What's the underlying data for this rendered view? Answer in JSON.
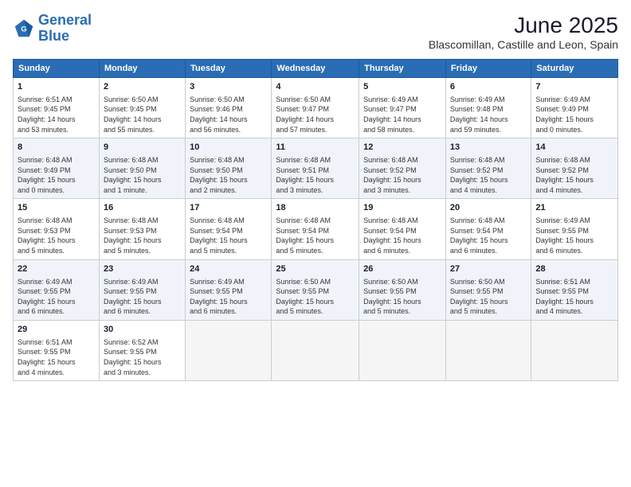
{
  "logo": {
    "line1": "General",
    "line2": "Blue"
  },
  "title": "June 2025",
  "subtitle": "Blascomillan, Castille and Leon, Spain",
  "headers": [
    "Sunday",
    "Monday",
    "Tuesday",
    "Wednesday",
    "Thursday",
    "Friday",
    "Saturday"
  ],
  "weeks": [
    [
      {
        "day": "1",
        "info": "Sunrise: 6:51 AM\nSunset: 9:45 PM\nDaylight: 14 hours\nand 53 minutes."
      },
      {
        "day": "2",
        "info": "Sunrise: 6:50 AM\nSunset: 9:45 PM\nDaylight: 14 hours\nand 55 minutes."
      },
      {
        "day": "3",
        "info": "Sunrise: 6:50 AM\nSunset: 9:46 PM\nDaylight: 14 hours\nand 56 minutes."
      },
      {
        "day": "4",
        "info": "Sunrise: 6:50 AM\nSunset: 9:47 PM\nDaylight: 14 hours\nand 57 minutes."
      },
      {
        "day": "5",
        "info": "Sunrise: 6:49 AM\nSunset: 9:47 PM\nDaylight: 14 hours\nand 58 minutes."
      },
      {
        "day": "6",
        "info": "Sunrise: 6:49 AM\nSunset: 9:48 PM\nDaylight: 14 hours\nand 59 minutes."
      },
      {
        "day": "7",
        "info": "Sunrise: 6:49 AM\nSunset: 9:49 PM\nDaylight: 15 hours\nand 0 minutes."
      }
    ],
    [
      {
        "day": "8",
        "info": "Sunrise: 6:48 AM\nSunset: 9:49 PM\nDaylight: 15 hours\nand 0 minutes."
      },
      {
        "day": "9",
        "info": "Sunrise: 6:48 AM\nSunset: 9:50 PM\nDaylight: 15 hours\nand 1 minute."
      },
      {
        "day": "10",
        "info": "Sunrise: 6:48 AM\nSunset: 9:50 PM\nDaylight: 15 hours\nand 2 minutes."
      },
      {
        "day": "11",
        "info": "Sunrise: 6:48 AM\nSunset: 9:51 PM\nDaylight: 15 hours\nand 3 minutes."
      },
      {
        "day": "12",
        "info": "Sunrise: 6:48 AM\nSunset: 9:52 PM\nDaylight: 15 hours\nand 3 minutes."
      },
      {
        "day": "13",
        "info": "Sunrise: 6:48 AM\nSunset: 9:52 PM\nDaylight: 15 hours\nand 4 minutes."
      },
      {
        "day": "14",
        "info": "Sunrise: 6:48 AM\nSunset: 9:52 PM\nDaylight: 15 hours\nand 4 minutes."
      }
    ],
    [
      {
        "day": "15",
        "info": "Sunrise: 6:48 AM\nSunset: 9:53 PM\nDaylight: 15 hours\nand 5 minutes."
      },
      {
        "day": "16",
        "info": "Sunrise: 6:48 AM\nSunset: 9:53 PM\nDaylight: 15 hours\nand 5 minutes."
      },
      {
        "day": "17",
        "info": "Sunrise: 6:48 AM\nSunset: 9:54 PM\nDaylight: 15 hours\nand 5 minutes."
      },
      {
        "day": "18",
        "info": "Sunrise: 6:48 AM\nSunset: 9:54 PM\nDaylight: 15 hours\nand 5 minutes."
      },
      {
        "day": "19",
        "info": "Sunrise: 6:48 AM\nSunset: 9:54 PM\nDaylight: 15 hours\nand 6 minutes."
      },
      {
        "day": "20",
        "info": "Sunrise: 6:48 AM\nSunset: 9:54 PM\nDaylight: 15 hours\nand 6 minutes."
      },
      {
        "day": "21",
        "info": "Sunrise: 6:49 AM\nSunset: 9:55 PM\nDaylight: 15 hours\nand 6 minutes."
      }
    ],
    [
      {
        "day": "22",
        "info": "Sunrise: 6:49 AM\nSunset: 9:55 PM\nDaylight: 15 hours\nand 6 minutes."
      },
      {
        "day": "23",
        "info": "Sunrise: 6:49 AM\nSunset: 9:55 PM\nDaylight: 15 hours\nand 6 minutes."
      },
      {
        "day": "24",
        "info": "Sunrise: 6:49 AM\nSunset: 9:55 PM\nDaylight: 15 hours\nand 6 minutes."
      },
      {
        "day": "25",
        "info": "Sunrise: 6:50 AM\nSunset: 9:55 PM\nDaylight: 15 hours\nand 5 minutes."
      },
      {
        "day": "26",
        "info": "Sunrise: 6:50 AM\nSunset: 9:55 PM\nDaylight: 15 hours\nand 5 minutes."
      },
      {
        "day": "27",
        "info": "Sunrise: 6:50 AM\nSunset: 9:55 PM\nDaylight: 15 hours\nand 5 minutes."
      },
      {
        "day": "28",
        "info": "Sunrise: 6:51 AM\nSunset: 9:55 PM\nDaylight: 15 hours\nand 4 minutes."
      }
    ],
    [
      {
        "day": "29",
        "info": "Sunrise: 6:51 AM\nSunset: 9:55 PM\nDaylight: 15 hours\nand 4 minutes."
      },
      {
        "day": "30",
        "info": "Sunrise: 6:52 AM\nSunset: 9:55 PM\nDaylight: 15 hours\nand 3 minutes."
      },
      {
        "day": "",
        "info": ""
      },
      {
        "day": "",
        "info": ""
      },
      {
        "day": "",
        "info": ""
      },
      {
        "day": "",
        "info": ""
      },
      {
        "day": "",
        "info": ""
      }
    ]
  ],
  "colors": {
    "header_bg": "#2a6db5",
    "header_text": "#ffffff",
    "logo_blue": "#2a6db5",
    "logo_dark": "#1a1a2e"
  }
}
